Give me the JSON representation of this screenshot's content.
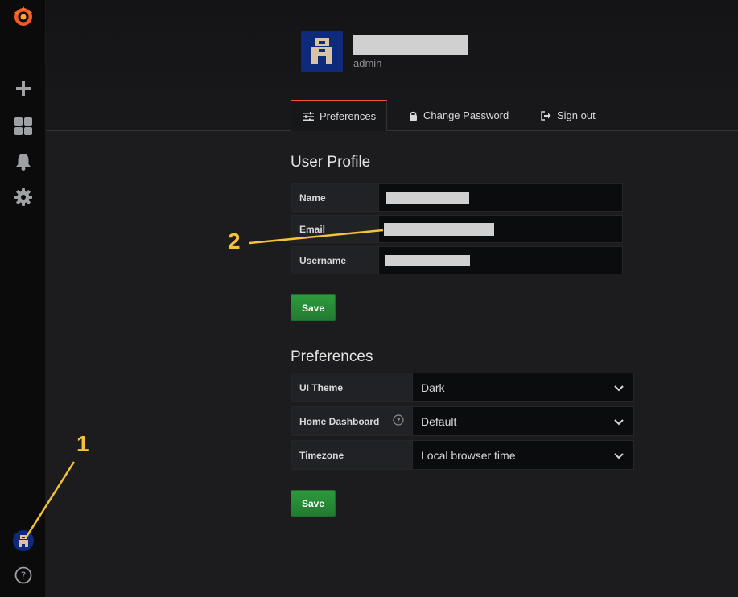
{
  "profile": {
    "role": "admin"
  },
  "tabs": [
    {
      "label": "Preferences",
      "icon": "sliders-icon"
    },
    {
      "label": "Change Password",
      "icon": "lock-icon"
    },
    {
      "label": "Sign out",
      "icon": "sign-out-icon"
    }
  ],
  "user_profile": {
    "heading": "User Profile",
    "fields": [
      {
        "label": "Name"
      },
      {
        "label": "Email"
      },
      {
        "label": "Username"
      }
    ],
    "save_label": "Save"
  },
  "preferences": {
    "heading": "Preferences",
    "rows": [
      {
        "label": "UI Theme",
        "value": "Dark"
      },
      {
        "label": "Home Dashboard",
        "value": "Default"
      },
      {
        "label": "Timezone",
        "value": "Local browser time"
      }
    ],
    "save_label": "Save"
  },
  "annotations": {
    "one": "1",
    "two": "2"
  },
  "colors": {
    "accent": "#f05a28",
    "save_green": "#2d9a3d",
    "annotation": "#f5c23a",
    "avatar_bg": "#0e2a7a"
  }
}
